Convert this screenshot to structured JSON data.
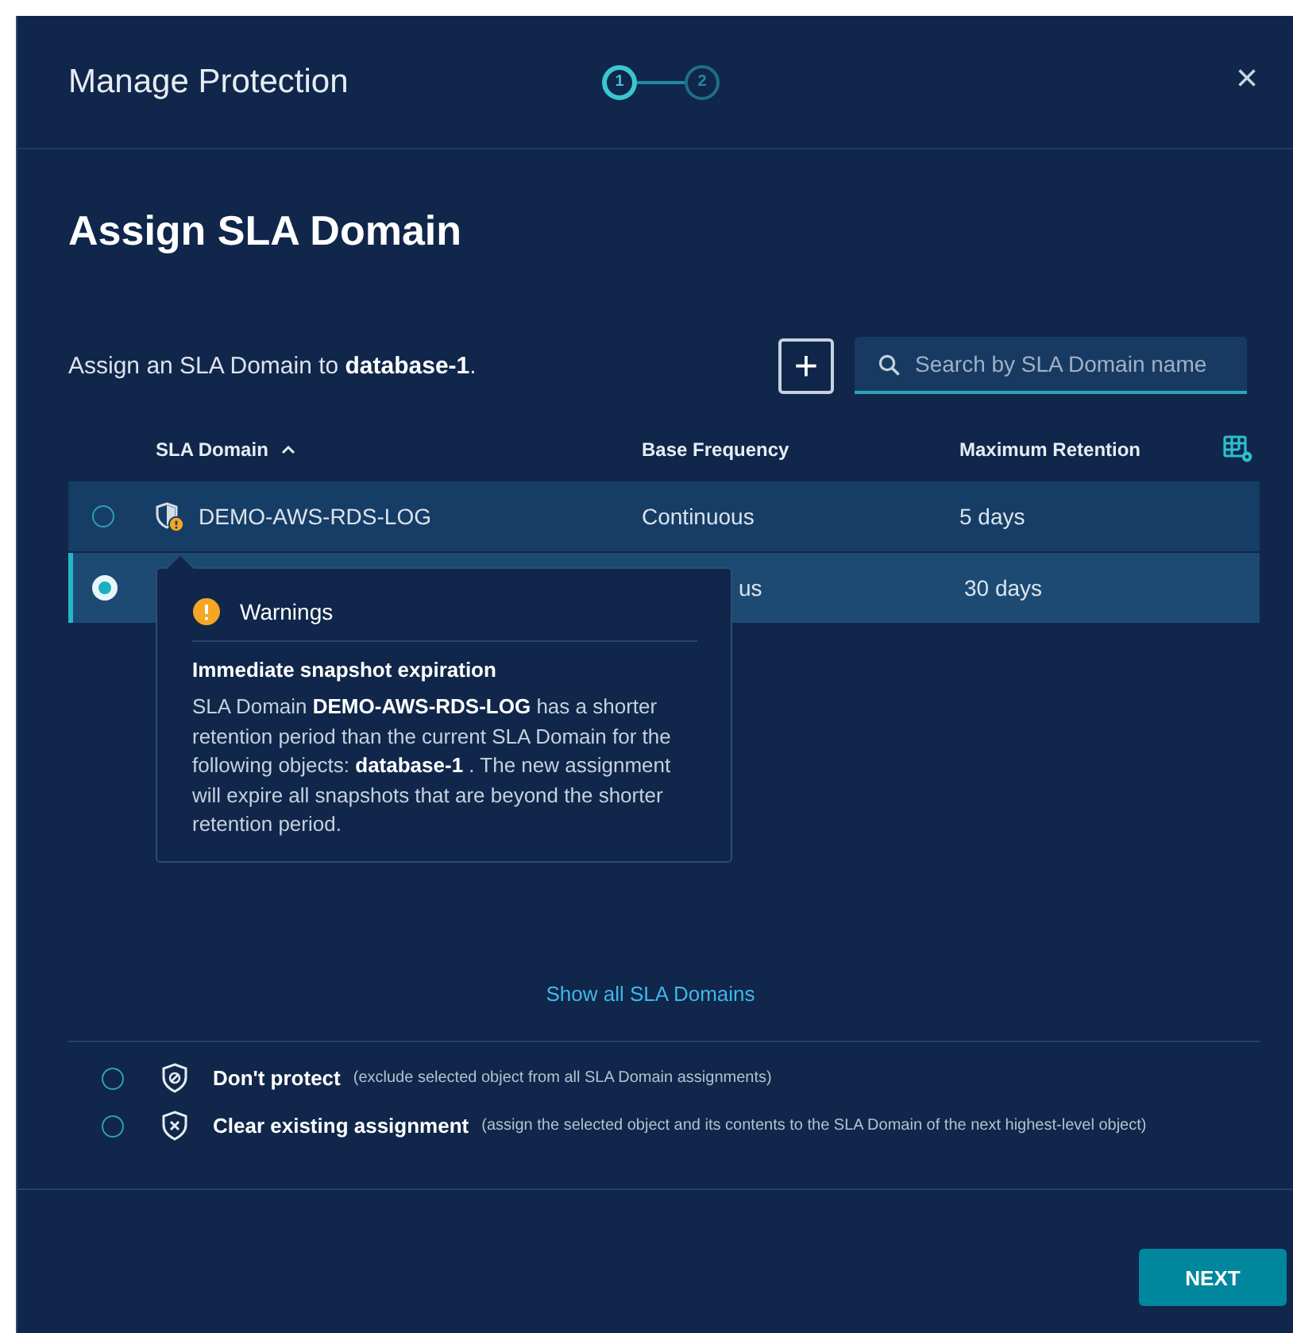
{
  "modal": {
    "title": "Manage Protection",
    "close": "×"
  },
  "steps": [
    {
      "label": "1",
      "selected": true
    },
    {
      "label": "2",
      "selected": false
    }
  ],
  "heading": "Assign SLA Domain",
  "description": "Assign an SLA Domain to **database-1**.",
  "add_button": "+",
  "search": {
    "placeholder": "Search by SLA Domain name"
  },
  "table": {
    "columns": [
      {
        "label": "SLA Domain",
        "sorted": true
      },
      {
        "label": "Base Frequency"
      },
      {
        "label": "Maximum Retention"
      }
    ],
    "rows": [
      {
        "selected": false,
        "warning": true,
        "name": "DEMO-AWS-RDS-LOG",
        "frequency": "Continuous",
        "retention": "5 days"
      },
      {
        "selected": true,
        "frequency": "us",
        "retention": "30 days"
      }
    ]
  },
  "tooltip": {
    "title": "Warnings",
    "subtitle": "Immediate snapshot expiration",
    "body": "SLA Domain **DEMO-AWS-RDS-LOG** has a shorter retention period than the current SLA Domain for the following objects: **database-1**  . The new assignment will expire all snapshots that are beyond the shorter retention period."
  },
  "show_all_link": "Show all SLA Domains",
  "options": [
    {
      "kind": "dont_protect",
      "selected": false,
      "label": "Don't protect",
      "note": "(exclude selected object from all SLA Domain assignments)"
    },
    {
      "kind": "clear",
      "selected": false,
      "label": "Clear existing assignment",
      "note": "(assign the selected object and its contents to the SLA Domain of the next highest-level object)"
    }
  ],
  "next_button": "NEXT"
}
